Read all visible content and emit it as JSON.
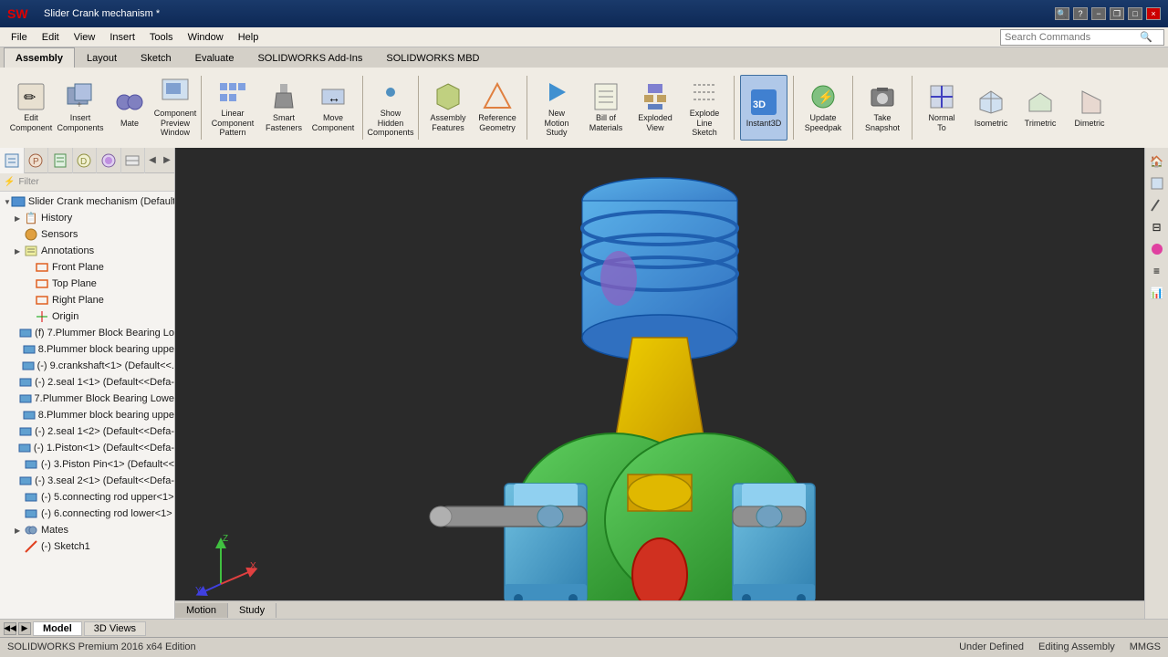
{
  "titlebar": {
    "title": "Slider Crank mechanism *",
    "logo_alt": "SOLIDWORKS",
    "search_placeholder": "Search Commands",
    "min_label": "−",
    "max_label": "□",
    "close_label": "×",
    "help_icon": "?",
    "restore_label": "❐"
  },
  "menubar": {
    "items": [
      "File",
      "Edit",
      "View",
      "Insert",
      "Tools",
      "Window",
      "Help"
    ]
  },
  "ribbon": {
    "tabs": [
      "Assembly",
      "Layout",
      "Sketch",
      "Evaluate",
      "SOLIDWORKS Add-Ins",
      "SOLIDWORKS MBD"
    ],
    "active_tab": "Assembly",
    "tools": [
      {
        "id": "edit-component",
        "label": "Edit\nComponent",
        "icon": "✏"
      },
      {
        "id": "insert-components",
        "label": "Insert\nComponents",
        "icon": "📦"
      },
      {
        "id": "mate",
        "label": "Mate",
        "icon": "🔗"
      },
      {
        "id": "component-preview",
        "label": "Component\nPreview\nWindow",
        "icon": "👁"
      },
      {
        "id": "linear-component",
        "label": "Linear Component\nPattern",
        "icon": "⊞"
      },
      {
        "id": "smart-fasteners",
        "label": "Smart\nFasteners",
        "icon": "🔩"
      },
      {
        "id": "move-component",
        "label": "Move\nComponent",
        "icon": "↔"
      },
      {
        "id": "show-hidden",
        "label": "Show\nHidden\nComponents",
        "icon": "◎"
      },
      {
        "id": "assembly-features",
        "label": "Assembly\nFeatures",
        "icon": "⚙"
      },
      {
        "id": "reference-geometry",
        "label": "Reference\nGeometry",
        "icon": "△"
      },
      {
        "id": "new-motion-study",
        "label": "New\nMotion\nStudy",
        "icon": "▶"
      },
      {
        "id": "bill-materials",
        "label": "Bill of\nMaterials",
        "icon": "📋"
      },
      {
        "id": "exploded-view",
        "label": "Exploded\nView",
        "icon": "💥"
      },
      {
        "id": "explode-line",
        "label": "Explode\nLine\nSketch",
        "icon": "---"
      },
      {
        "id": "instant3d",
        "label": "Instant3D",
        "icon": "3D"
      },
      {
        "id": "update-speedpak",
        "label": "Update\nSpeedpak",
        "icon": "⚡"
      },
      {
        "id": "take-snapshot",
        "label": "Take\nSnapshot",
        "icon": "📷"
      },
      {
        "id": "normal-to",
        "label": "Normal\nTo",
        "icon": "⊥"
      },
      {
        "id": "isometric",
        "label": "Isometric",
        "icon": "◈"
      },
      {
        "id": "trimetric",
        "label": "Trimetric",
        "icon": "◇"
      },
      {
        "id": "dimetric",
        "label": "Dimetric",
        "icon": "◆"
      }
    ]
  },
  "panel": {
    "tabs": [
      "feature-tree",
      "property-manager",
      "configuration-manager",
      "dimension-expert",
      "appearances",
      "display-pane"
    ],
    "filter_placeholder": "Filter",
    "root_item": "Slider Crank mechanism (Default",
    "tree_items": [
      {
        "id": "history",
        "label": "History",
        "indent": 1,
        "has_arrow": true,
        "icon": "📋"
      },
      {
        "id": "sensors",
        "label": "Sensors",
        "indent": 1,
        "has_arrow": false,
        "icon": "📡"
      },
      {
        "id": "annotations",
        "label": "Annotations",
        "indent": 1,
        "has_arrow": false,
        "icon": "📝"
      },
      {
        "id": "front-plane",
        "label": "Front Plane",
        "indent": 2,
        "has_arrow": false,
        "icon": "▭"
      },
      {
        "id": "top-plane",
        "label": "Top Plane",
        "indent": 2,
        "has_arrow": false,
        "icon": "▭"
      },
      {
        "id": "right-plane",
        "label": "Right Plane",
        "indent": 2,
        "has_arrow": false,
        "icon": "▭"
      },
      {
        "id": "origin",
        "label": "Origin",
        "indent": 2,
        "has_arrow": false,
        "icon": "✛"
      },
      {
        "id": "part7-plummer-upper",
        "label": "(f) 7.Plummer Block Bearing Lo",
        "indent": 1,
        "has_arrow": false,
        "icon": "⚙"
      },
      {
        "id": "part8-plummer-upper",
        "label": "8.Plummer block bearing uppe",
        "indent": 1,
        "has_arrow": false,
        "icon": "⚙"
      },
      {
        "id": "part9-crankshaft",
        "label": "(-) 9.crankshaft<1> (Default<<.",
        "indent": 1,
        "has_arrow": false,
        "icon": "⚙"
      },
      {
        "id": "part2-seal1",
        "label": "(-) 2.seal 1<1> (Default<<Defa-",
        "indent": 1,
        "has_arrow": false,
        "icon": "⚙"
      },
      {
        "id": "part7-plummer-lower",
        "label": "7.Plummer Block Bearing Lowe",
        "indent": 1,
        "has_arrow": false,
        "icon": "⚙"
      },
      {
        "id": "part8-bearing-uppe",
        "label": "8.Plummer block bearing uppe",
        "indent": 1,
        "has_arrow": false,
        "icon": "⚙"
      },
      {
        "id": "part2-seal2",
        "label": "(-) 2.seal 1<2> (Default<<Defa-",
        "indent": 1,
        "has_arrow": false,
        "icon": "⚙"
      },
      {
        "id": "part1-piston",
        "label": "(-) 1.Piston<1> (Default<<Defa-",
        "indent": 1,
        "has_arrow": false,
        "icon": "⚙"
      },
      {
        "id": "part3-piston-pin",
        "label": "(-) 3.Piston Pin<1> (Default<<",
        "indent": 1,
        "has_arrow": false,
        "icon": "⚙"
      },
      {
        "id": "part3-seal2",
        "label": "(-) 3.seal 2<1> (Default<<Defa-",
        "indent": 1,
        "has_arrow": false,
        "icon": "⚙"
      },
      {
        "id": "part5-conn-upper",
        "label": "(-) 5.connecting rod upper<1>",
        "indent": 1,
        "has_arrow": false,
        "icon": "⚙"
      },
      {
        "id": "part6-conn-lower",
        "label": "(-) 6.connecting rod lower<1>",
        "indent": 1,
        "has_arrow": false,
        "icon": "⚙"
      },
      {
        "id": "mates",
        "label": "Mates",
        "indent": 1,
        "has_arrow": false,
        "icon": "🔗"
      },
      {
        "id": "sketch1",
        "label": "(-) Sketch1",
        "indent": 1,
        "has_arrow": false,
        "icon": "✏"
      }
    ]
  },
  "right_panel": {
    "icons": [
      "🏠",
      "📄",
      "✏",
      "⊟",
      "🎨",
      "≡",
      "📊"
    ]
  },
  "bottom_tabs": {
    "scroll_prev": "◀",
    "scroll_next": "▶",
    "tabs": [
      "Model",
      "3D Views"
    ],
    "active_tab": "Model"
  },
  "statusbar": {
    "left": "SOLIDWORKS Premium 2016 x64 Edition",
    "status": "Under Defined",
    "editing": "Editing Assembly",
    "units": "MMGS"
  },
  "viewport": {
    "background_start": "#3a3a3a",
    "background_end": "#1a1a1a"
  },
  "motion_study": {
    "tab_label": "Motion",
    "study_label": "Study"
  }
}
